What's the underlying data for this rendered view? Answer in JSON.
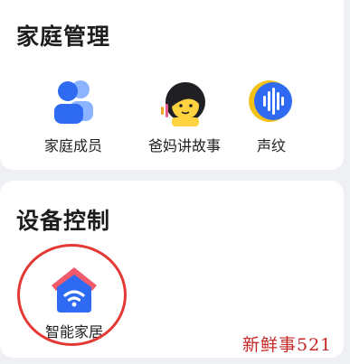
{
  "family_management": {
    "title": "家庭管理",
    "items": [
      {
        "label": "家庭成员",
        "icon": "family-members-icon"
      },
      {
        "label": "爸妈讲故事",
        "icon": "parent-story-icon"
      },
      {
        "label": "声纹",
        "icon": "voiceprint-icon"
      }
    ]
  },
  "device_control": {
    "title": "设备控制",
    "items": [
      {
        "label": "智能家居",
        "icon": "smart-home-icon"
      }
    ]
  },
  "watermark": "新鲜事521",
  "colors": {
    "accent_blue": "#2f6bf2",
    "light_blue": "#8cb3ff",
    "story_yellow": "#ffd23f",
    "voice_gold": "#f2c21a",
    "home_roof_red": "#f05a6a",
    "home_body_blue": "#2f6bf2",
    "highlight_red": "#e53935",
    "watermark_red": "#c62828"
  }
}
